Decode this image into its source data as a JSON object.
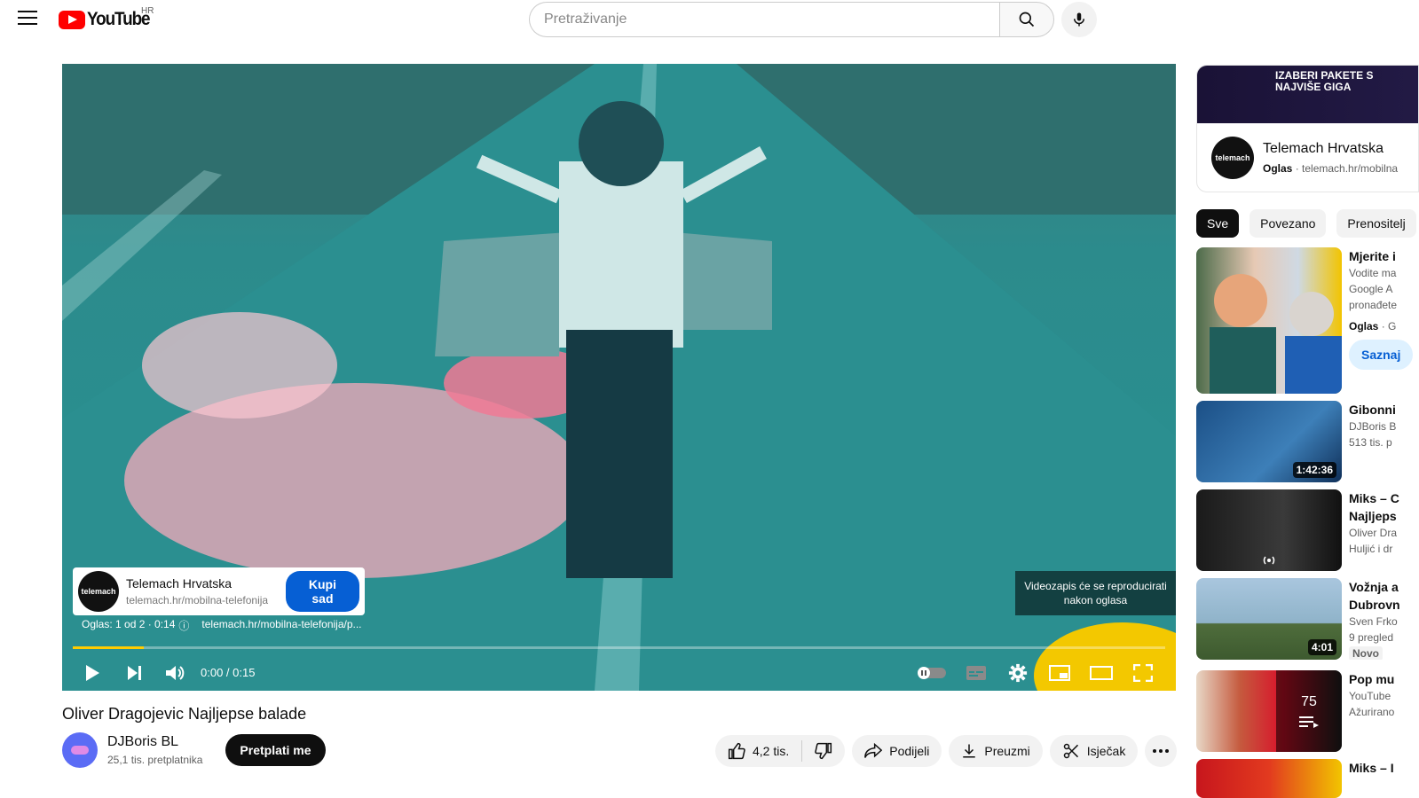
{
  "header": {
    "logo_text": "YouTube",
    "country": "HR",
    "search_placeholder": "Pretraživanje"
  },
  "player": {
    "ad_card": {
      "avatar_text": "telemach",
      "title": "Telemach Hrvatska",
      "url": "telemach.hr/mobilna-telefonija",
      "button": "Kupi sad"
    },
    "ad_meta": {
      "counter": "Oglas: 1 od 2 · 0:14",
      "link": "telemach.hr/mobilna-telefonija/p..."
    },
    "skip_text": "Videozapis će se reproducirati nakon oglasa",
    "time": "0:00 / 0:15",
    "progress": 0.065
  },
  "video": {
    "title": "Oliver Dragojevic Najljepse balade",
    "channel_name": "DJBoris BL",
    "subscribers": "25,1 tis. pretplatnika",
    "subscribe_label": "Pretplati me",
    "likes": "4,2 tis.",
    "share_label": "Podijeli",
    "download_label": "Preuzmi",
    "clip_label": "Isječak"
  },
  "sidebar": {
    "ad_banner": {
      "image_text": "IZABERI PAKETE S NAJVIŠE GIGA",
      "avatar_text": "telemach",
      "title": "Telemach Hrvatska",
      "label": "Oglas",
      "domain": "telemach.hr/mobilna"
    },
    "chips": [
      "Sve",
      "Povezano",
      "Prenositelj"
    ],
    "recommendations": [
      {
        "title": "Mjerite i",
        "line1": "Vodite ma",
        "line2": "Google A",
        "line3": "pronađete",
        "badge_label": "Oglas",
        "badge_tail": " · G",
        "cta": "Saznaj"
      },
      {
        "title": "Gibonni",
        "line1": "DJBoris B",
        "line2": "513 tis. p",
        "duration": "1:42:36"
      },
      {
        "title": "Miks – C",
        "title2": "Najljeps",
        "line1": "Oliver Dra",
        "line2": "Huljić i dr"
      },
      {
        "title": "Vožnja a",
        "title2": "Dubrovn",
        "line1": "Sven Frko",
        "line2": "9 pregled",
        "badge": "Novo",
        "duration": "4:01"
      },
      {
        "title": "Pop mu",
        "line1": "YouTube",
        "line2": "Ažurirano",
        "playlist_count": "75"
      },
      {
        "title": "Miks – I"
      }
    ]
  }
}
